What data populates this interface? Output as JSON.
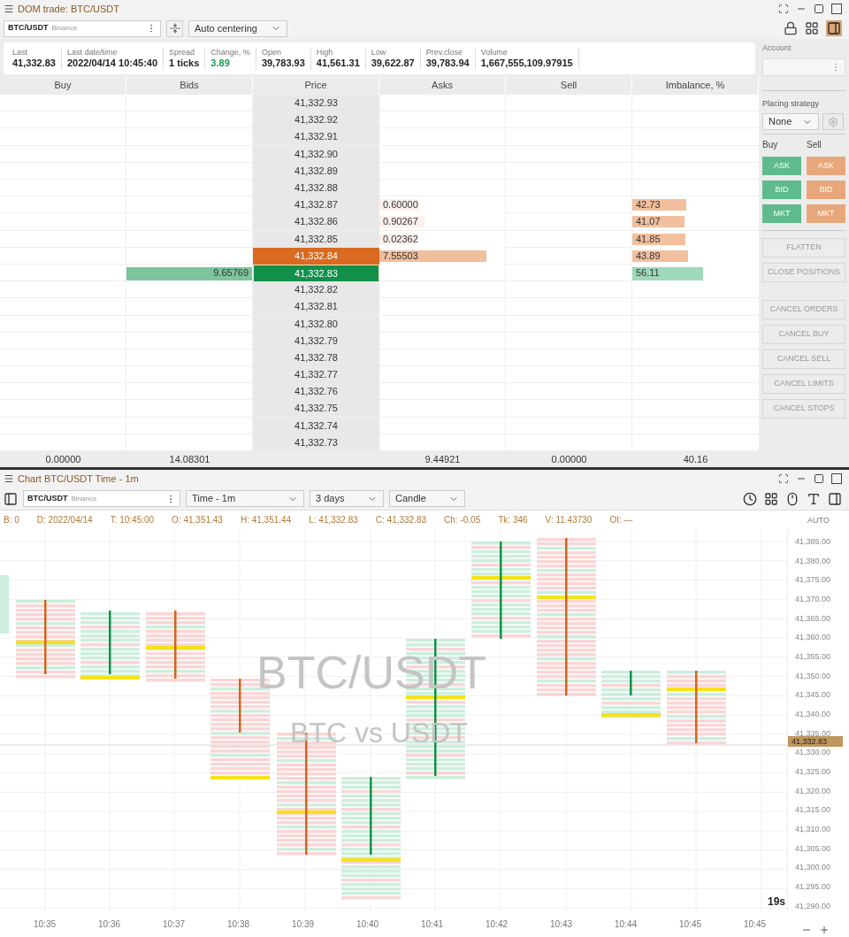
{
  "dom_window": {
    "title": "DOM trade: BTC/USDT",
    "symbol": {
      "ticker": "BTC/USDT",
      "exchange": "Binance"
    },
    "centering": "Auto centering",
    "stats": [
      {
        "label": "Last",
        "value": "41,332.83",
        "positive": false
      },
      {
        "label": "Last date/time",
        "value": "2022/04/14 10:45:40",
        "positive": false
      },
      {
        "label": "Spread",
        "value": "1 ticks",
        "positive": false
      },
      {
        "label": "Change, %",
        "value": "3.89",
        "positive": true
      },
      {
        "label": "Open",
        "value": "39,783.93",
        "positive": false
      },
      {
        "label": "High",
        "value": "41,561.31",
        "positive": false
      },
      {
        "label": "Low",
        "value": "39,622.87",
        "positive": false
      },
      {
        "label": "Prev.close",
        "value": "39,783.94",
        "positive": false
      },
      {
        "label": "Volume",
        "value": "1,667,555,109.97915",
        "positive": false
      }
    ],
    "columns": [
      "Buy",
      "Bids",
      "Price",
      "Asks",
      "Sell",
      "Imbalance, %"
    ],
    "rows": [
      {
        "price": "41,332.93",
        "best_ask": false,
        "best_bid": false
      },
      {
        "price": "41,332.92",
        "best_ask": false,
        "best_bid": false
      },
      {
        "price": "41,332.91",
        "best_ask": false,
        "best_bid": false
      },
      {
        "price": "41,332.90",
        "best_ask": false,
        "best_bid": false
      },
      {
        "price": "41,332.89",
        "best_ask": false,
        "best_bid": false
      },
      {
        "price": "41,332.88",
        "best_ask": false,
        "best_bid": false
      },
      {
        "price": "41,332.87",
        "best_ask": false,
        "best_bid": false,
        "asks": {
          "text": "0.60000",
          "level": 0.32
        },
        "imbalance": {
          "text": "42.73",
          "buy_side": false,
          "level": 0.43
        }
      },
      {
        "price": "41,332.86",
        "best_ask": false,
        "best_bid": false,
        "asks": {
          "text": "0.90267",
          "level": 0.36
        },
        "imbalance": {
          "text": "41.07",
          "buy_side": false,
          "level": 0.41
        }
      },
      {
        "price": "41,332.85",
        "best_ask": false,
        "best_bid": false,
        "asks": {
          "text": "0.02362",
          "level": 0.3
        },
        "imbalance": {
          "text": "41.85",
          "buy_side": false,
          "level": 0.42
        }
      },
      {
        "price": "41,332.84",
        "best_ask": true,
        "best_bid": false,
        "asks": {
          "text": "7.55503",
          "level": 0.85
        },
        "imbalance": {
          "text": "43.89",
          "buy_side": false,
          "level": 0.44
        }
      },
      {
        "price": "41,332.83",
        "best_ask": false,
        "best_bid": true,
        "bids": {
          "text": "9.65769",
          "level": 1
        },
        "imbalance": {
          "text": "56.11",
          "buy_side": true,
          "level": 0.56
        }
      },
      {
        "price": "41,332.82",
        "best_ask": false,
        "best_bid": false
      },
      {
        "price": "41,332.81",
        "best_ask": false,
        "best_bid": false
      },
      {
        "price": "41,332.80",
        "best_ask": false,
        "best_bid": false
      },
      {
        "price": "41,332.79",
        "best_ask": false,
        "best_bid": false
      },
      {
        "price": "41,332.78",
        "best_ask": false,
        "best_bid": false
      },
      {
        "price": "41,332.77",
        "best_ask": false,
        "best_bid": false
      },
      {
        "price": "41,332.76",
        "best_ask": false,
        "best_bid": false
      },
      {
        "price": "41,332.75",
        "best_ask": false,
        "best_bid": false
      },
      {
        "price": "41,332.74",
        "best_ask": false,
        "best_bid": false
      },
      {
        "price": "41,332.73",
        "best_ask": false,
        "best_bid": false
      }
    ],
    "totals": {
      "buy": "0.00000",
      "bids": "14.08301",
      "asks": "9.44921",
      "sell": "0.00000",
      "imbalance": "40.16"
    }
  },
  "order_panel": {
    "account_label": "Account",
    "strategy_label": "Placing strategy",
    "strategy": "None",
    "buy_label": "Buy",
    "sell_label": "Sell",
    "buy_buttons": [
      "ASK",
      "BID",
      "MKT"
    ],
    "sell_buttons": [
      "ASK",
      "BID",
      "MKT"
    ],
    "position_actions": [
      {
        "label": "FLATTEN",
        "disabled": true
      },
      {
        "label": "CLOSE POSITIONS",
        "disabled": true
      }
    ],
    "cancel_actions": [
      {
        "label": "CANCEL ORDERS",
        "disabled": true
      },
      {
        "label": "CANCEL BUY",
        "disabled": true
      },
      {
        "label": "CANCEL SELL",
        "disabled": true
      },
      {
        "label": "CANCEL LIMITS",
        "disabled": true
      },
      {
        "label": "CANCEL STOPS",
        "disabled": true
      }
    ]
  },
  "chart_window": {
    "title": "Chart BTC/USDT Time - 1m",
    "symbol": {
      "ticker": "BTC/USDT",
      "exchange": "Binance"
    },
    "timeframe": "Time - 1m",
    "range": "3 days",
    "style": "Candle",
    "info": [
      "B: 0",
      "D: 2022/04/14",
      "T: 10:45:00",
      "O: 41,351.43",
      "H: 41,351.44",
      "L: 41,332.83",
      "C: 41,332.83",
      "Ch: -0.05",
      "Tk: 346",
      "V: 11.43730",
      "OI: ---"
    ],
    "watermark": {
      "symbol": "BTC/USDT",
      "description": "BTC vs USDT"
    },
    "scale_mode": "AUTO",
    "y_labels": [
      "41,385.00",
      "41,380.00",
      "41,375.00",
      "41,370.00",
      "41,365.00",
      "41,360.00",
      "41,355.00",
      "41,350.00",
      "41,345.00",
      "41,340.00",
      "41,335.00",
      "41,330.00",
      "41,325.00",
      "41,320.00",
      "41,315.00",
      "41,310.00",
      "41,305.00",
      "41,300.00",
      "41,295.00",
      "41,290.00"
    ],
    "price_badge": "41,332.83",
    "timer": "19s",
    "x_labels": [
      "10:35",
      "10:36",
      "10:37",
      "10:38",
      "10:39",
      "10:40",
      "10:41",
      "10:42",
      "10:43",
      "10:44",
      "10:45",
      "10:45"
    ]
  }
}
